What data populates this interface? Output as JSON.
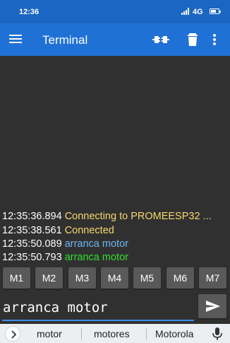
{
  "status_bar": {
    "time": "12:36",
    "network": "4G",
    "battery_level": 0.7
  },
  "app_bar": {
    "title": "Terminal"
  },
  "terminal": {
    "lines": [
      {
        "timestamp": "12:35:36.894",
        "text": "Connecting to PROMEESP32 ...",
        "color": "#f5d76e"
      },
      {
        "timestamp": "12:35:38.561",
        "text": "Connected",
        "color": "#f5d76e"
      },
      {
        "timestamp": "12:35:50.089",
        "text": "arranca motor",
        "color": "#6fb6f5"
      },
      {
        "timestamp": "12:35:50.793",
        "text": "arranca motor",
        "color": "#2fe02f"
      }
    ]
  },
  "macros": [
    "M1",
    "M2",
    "M3",
    "M4",
    "M5",
    "M6",
    "M7"
  ],
  "input": {
    "value": "arranca motor"
  },
  "keyboard": {
    "suggestions": [
      "motor",
      "motores",
      "Motorola"
    ]
  },
  "colors": {
    "status_bar": "#1a66c2",
    "app_bar": "#1f71d6",
    "background": "#303030",
    "accent": "#3f8fe8"
  }
}
